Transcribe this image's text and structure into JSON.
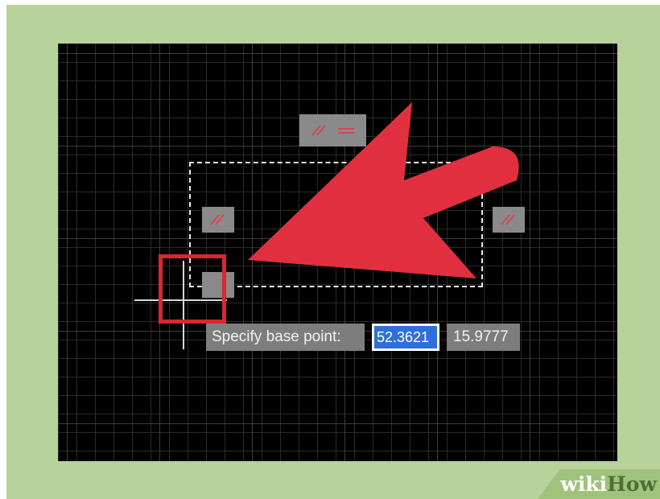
{
  "prompt": {
    "label": "Specify base point:",
    "x_value": "52.3621",
    "y_value": "15.9777"
  },
  "watermark": {
    "part1": "wiki",
    "part2": "How"
  },
  "colors": {
    "background": "#b7d39b",
    "canvas": "#000000",
    "arrow": "#e03040",
    "highlight": "#d7282f",
    "input_selected": "#2f6fdc"
  }
}
